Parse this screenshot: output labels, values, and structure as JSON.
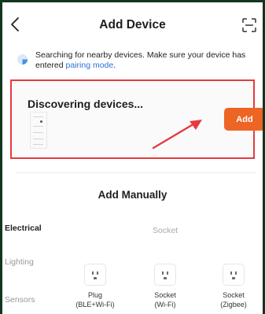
{
  "header": {
    "title": "Add Device"
  },
  "notice": {
    "text": "Searching for nearby devices. Make sure your device has entered ",
    "link": "pairing mode",
    "tail": "."
  },
  "discovery": {
    "title": "Discovering devices...",
    "add_label": "Add"
  },
  "manual": {
    "title": "Add Manually"
  },
  "categories": [
    {
      "label": "Electrical",
      "active": true
    },
    {
      "label": "Lighting",
      "active": false
    },
    {
      "label": "Sensors",
      "active": false
    }
  ],
  "section": {
    "label": "Socket"
  },
  "products": [
    {
      "name": "Plug",
      "sub": "(BLE+Wi-Fi)",
      "icon": "socket-icon"
    },
    {
      "name": "Socket",
      "sub": "(Wi-Fi)",
      "icon": "socket-icon"
    },
    {
      "name": "Socket",
      "sub": "(Zigbee)",
      "icon": "socket-icon"
    }
  ],
  "colors": {
    "accent": "#ec6525",
    "highlight_border": "#e53b3f",
    "link": "#2f6fd8",
    "frame": "#14351f"
  }
}
